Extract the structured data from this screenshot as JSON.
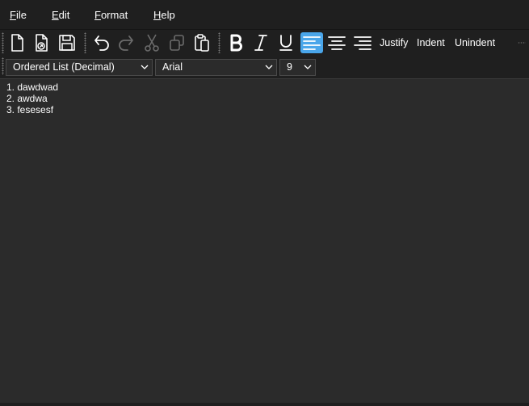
{
  "menu": {
    "file": {
      "underline": "F",
      "rest": "ile"
    },
    "edit": {
      "underline": "E",
      "rest": "dit"
    },
    "format": {
      "underline": "F",
      "rest": "ormat"
    },
    "help": {
      "underline": "H",
      "rest": "elp"
    }
  },
  "toolbar": {
    "justify_label": "Justify",
    "indent_label": "Indent",
    "unindent_label": "Unindent",
    "icons": [
      "new-file-icon",
      "open-file-icon",
      "save-icon",
      "undo-icon",
      "redo-icon",
      "cut-icon",
      "copy-icon",
      "paste-icon",
      "bold-icon",
      "italic-icon",
      "underline-icon",
      "align-left-icon",
      "align-center-icon",
      "align-right-icon"
    ],
    "active_color": "#4aa6ea"
  },
  "format": {
    "list_style": "Ordered List (Decimal)",
    "font_family": "Arial",
    "font_size": "9"
  },
  "document": {
    "lines": [
      "1. dawdwad",
      "2. awdwa",
      "3. fesesesf"
    ]
  }
}
